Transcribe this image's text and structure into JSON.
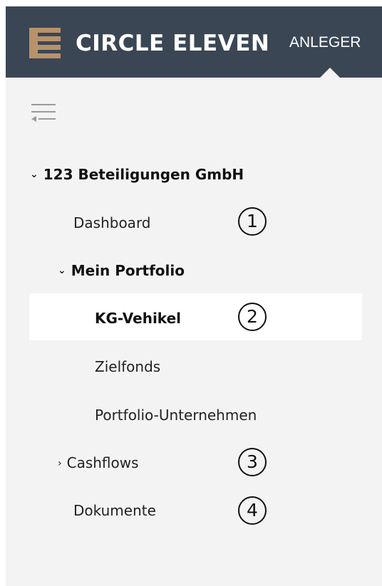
{
  "header": {
    "brand": "CIRCLE ELEVEN",
    "section": "ANLEGER",
    "logo_color": "#b8926a",
    "background": "#3b4654"
  },
  "sidebar": {
    "collapse_icon": "menu-collapse-icon",
    "company": {
      "label": "123 Beteiligungen GmbH",
      "expanded": true
    },
    "items": {
      "dashboard": "Dashboard",
      "portfolio": "Mein Portfolio",
      "kg_vehikel": "KG-Vehikel",
      "zielfonds": "Zielfonds",
      "portfolio_unternehmen": "Portfolio-Unternehmen",
      "cashflows": "Cashflows",
      "dokumente": "Dokumente"
    },
    "active_item": "KG-Vehikel"
  },
  "markers": [
    "1",
    "2",
    "3",
    "4"
  ]
}
